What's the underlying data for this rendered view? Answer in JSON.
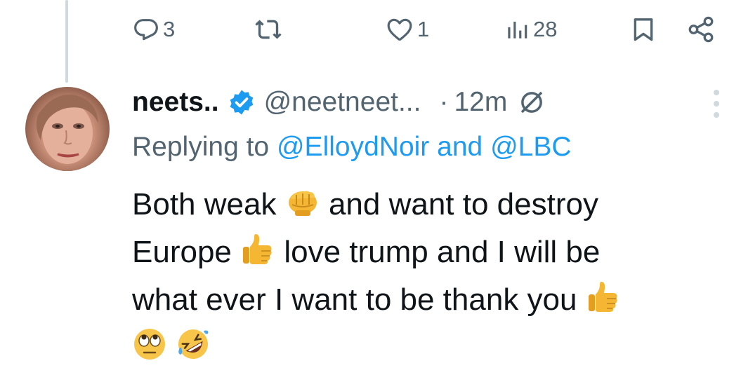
{
  "actions": {
    "reply_count": "3",
    "retweet_count": "",
    "like_count": "1",
    "views_count": "28"
  },
  "tweet": {
    "display_name": "neets..",
    "handle": "@neetneet...",
    "dot": "·",
    "time": "12m",
    "replying_prefix": "Replying to",
    "mention_1": "@ElloydNoir",
    "mention_join": "and",
    "mention_2": "@LBC",
    "line_1a": "Both weak",
    "line_1b": "and want to destroy",
    "line_2a": "Europe",
    "line_2b": "love trump and I will be",
    "line_3a": "what ever I want to be thank you"
  },
  "icons": {
    "reply": "reply-icon",
    "retweet": "retweet-icon",
    "like": "heart-icon",
    "views": "views-chart-icon",
    "bookmark": "bookmark-icon",
    "share": "share-icon",
    "verified": "verified-badge-icon",
    "translate": "no-translate-icon",
    "more": "more-options-icon",
    "emoji_1": "fist-emoji",
    "emoji_2": "thumbs-up-emoji",
    "emoji_3": "thumbs-up-emoji",
    "emoji_4": "eye-roll-emoji",
    "emoji_5": "rolling-laughing-emoji"
  },
  "colors": {
    "text": "#0f1419",
    "secondary": "#536471",
    "link": "#1d9bf0",
    "thread_line": "#cfd9de"
  }
}
